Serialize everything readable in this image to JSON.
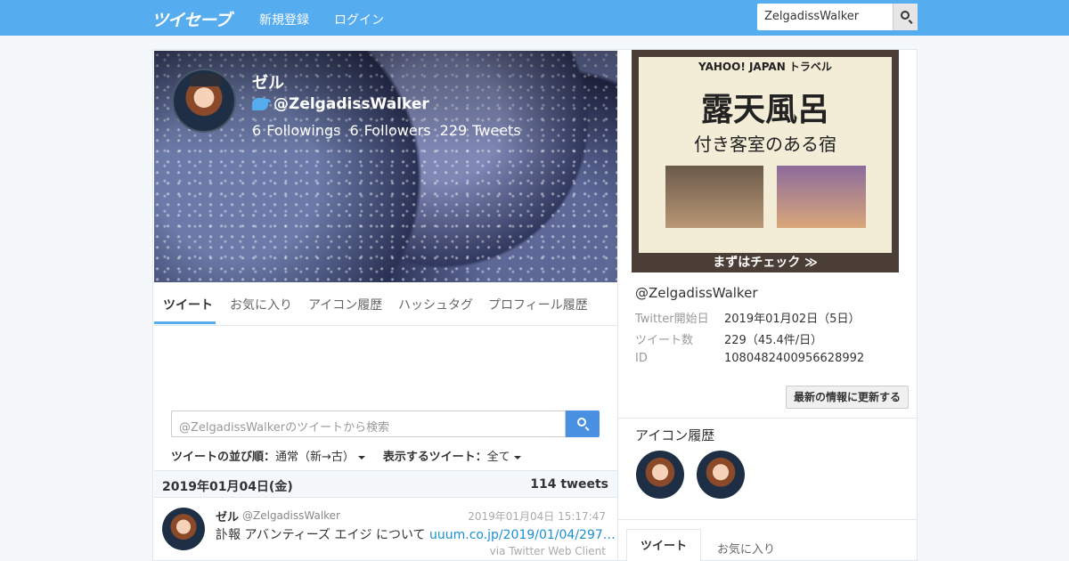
{
  "header": {
    "logo": "ツイセーブ",
    "nav": [
      "新規登録",
      "ログイン"
    ],
    "search_value": "ZelgadissWalker"
  },
  "profile": {
    "name": "ゼル",
    "handle": "@ZelgadissWalker",
    "followings_count": "6",
    "followings_label": "Followings",
    "followers_count": "6",
    "followers_label": "Followers",
    "tweets_count": "229",
    "tweets_label": "Tweets"
  },
  "tabs": [
    "ツイート",
    "お気に入り",
    "アイコン履歴",
    "ハッシュタグ",
    "プロフィール履歴"
  ],
  "tweet_search": {
    "placeholder": "@ZelgadissWalkerのツイートから検索"
  },
  "sort": {
    "order_label": "ツイートの並び順：",
    "order_value": "通常（新→古）",
    "filter_label": "表示するツイート：",
    "filter_value": "全て"
  },
  "day": {
    "date": "2019年01月04日(金)",
    "count": "114 tweets"
  },
  "tweet": {
    "name": "ゼル",
    "handle": "@ZelgadissWalker",
    "time": "2019年01月04日 15:17:47",
    "text": "訃報 アバンティーズ エイジ について ",
    "link": "uuum.co.jp/2019/01/04/297…",
    "via": "via Twitter Web Client"
  },
  "ad": {
    "brand": "YAHOO! JAPAN トラベル",
    "headline": "露天風呂",
    "subline": "付き客室のある宿",
    "cta": "まずはチェック ≫"
  },
  "sidebar": {
    "handle": "@ZelgadissWalker",
    "rows": [
      {
        "k": "Twitter開始日",
        "v": "2019年01月02日（5日）"
      },
      {
        "k": "ツイート数",
        "v": "229（45.4件/日）"
      },
      {
        "k": "ID",
        "v": "1080482400956628992"
      }
    ],
    "update_button": "最新の情報に更新する",
    "icon_history_title": "アイコン履歴",
    "tabs": [
      "ツイート",
      "お気に入り"
    ]
  },
  "colors": {
    "topbar": "#55acee",
    "link": "#1b8fd2",
    "search_button": "#4a90e2"
  }
}
